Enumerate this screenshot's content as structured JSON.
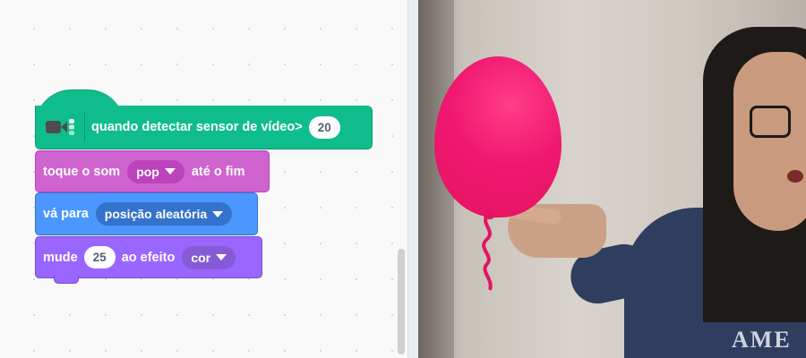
{
  "code_blocks": {
    "hat": {
      "label": "quando detectar sensor de vídeo>",
      "value": "20",
      "icon": "video-sensing-icon"
    },
    "sound": {
      "label_before": "toque o som",
      "dropdown": "pop",
      "label_after": "até o fim"
    },
    "motion": {
      "label": "vá para",
      "dropdown": "posição aleatória"
    },
    "looks": {
      "label_before": "mude",
      "value": "25",
      "label_middle": "ao efeito",
      "dropdown": "cor"
    }
  },
  "stage": {
    "sprite": "balloon",
    "shirt_text": "AME"
  },
  "colors": {
    "events_green": "#0fbd8c",
    "sound_magenta": "#cf63cf",
    "motion_blue": "#4c97ff",
    "looks_purple": "#9966ff",
    "balloon_pink": "#f01770"
  }
}
